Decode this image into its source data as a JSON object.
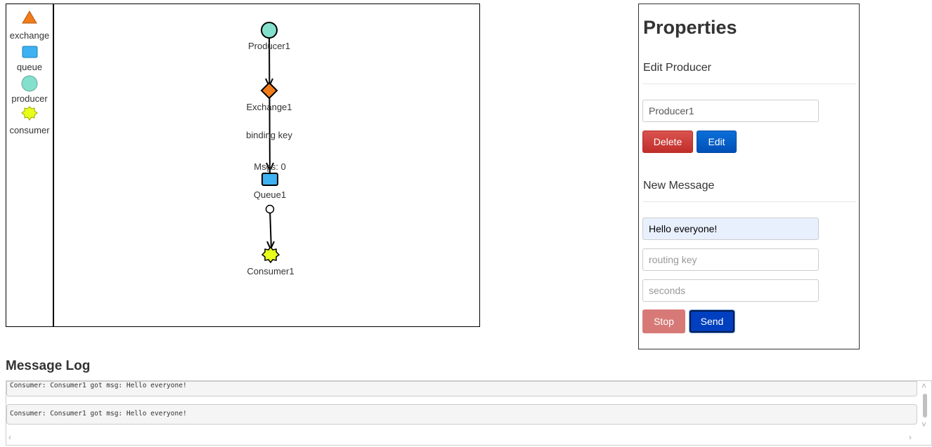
{
  "palette": {
    "items": [
      {
        "label": "exchange",
        "icon": "triangle-icon",
        "color": "#f07c1a"
      },
      {
        "label": "queue",
        "icon": "square-icon",
        "color": "#3db1f1"
      },
      {
        "label": "producer",
        "icon": "circle-icon",
        "color": "#84e0cc"
      },
      {
        "label": "consumer",
        "icon": "star-icon",
        "color": "#e8ff1a"
      }
    ]
  },
  "diagram": {
    "producer": "Producer1",
    "exchange": "Exchange1",
    "binding": "binding key",
    "msgs": "Msgs: 0",
    "queue": "Queue1",
    "consumer": "Consumer1"
  },
  "properties": {
    "title": "Properties",
    "edit_heading": "Edit Producer",
    "name_value": "Producer1",
    "delete_label": "Delete",
    "edit_label": "Edit",
    "new_message_heading": "New Message",
    "message_value": "Hello everyone!",
    "routing_placeholder": "routing key",
    "seconds_placeholder": "seconds",
    "stop_label": "Stop",
    "send_label": "Send"
  },
  "log": {
    "title": "Message Log",
    "entries": [
      "Consumer: Consumer1 got msg:  Hello everyone!",
      "Consumer: Consumer1 got msg:  Hello everyone!"
    ]
  }
}
